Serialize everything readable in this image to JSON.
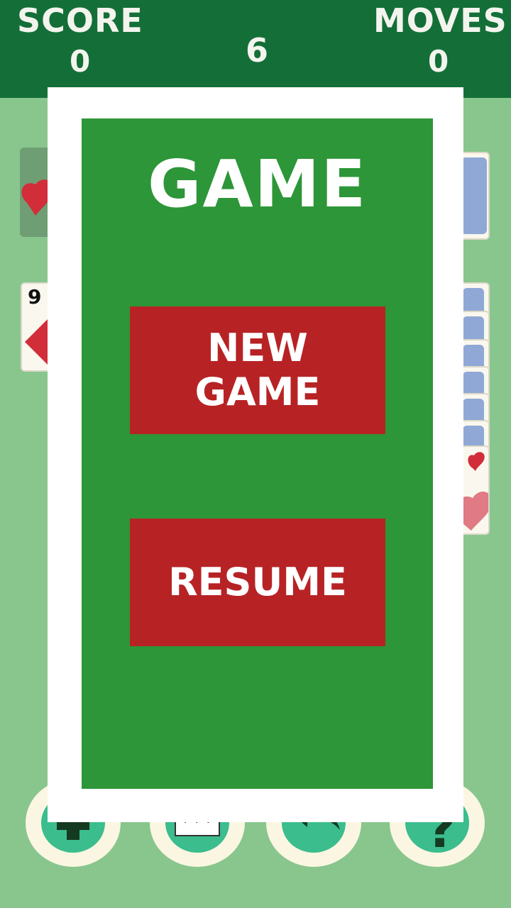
{
  "header": {
    "score_label": "SCORE",
    "score_value": "0",
    "moves_label": "MOVES",
    "moves_value": "0",
    "timer": "6"
  },
  "tableau": {
    "visible_card_rank": "9",
    "visible_card_suit": "diamond",
    "foundation_suit": "heart"
  },
  "bottom_bar": {
    "buttons": [
      "plus-icon",
      "cards-icon",
      "undo-icon",
      "help-icon"
    ]
  },
  "modal": {
    "title": "GAME",
    "new_game_line1": "NEW",
    "new_game_line2": "GAME",
    "resume_label": "RESUME"
  },
  "colors": {
    "felt": "#88c68e",
    "header": "#136f37",
    "panel": "#2d9638",
    "button": "#b72325",
    "suit_red": "#d12e3a"
  }
}
